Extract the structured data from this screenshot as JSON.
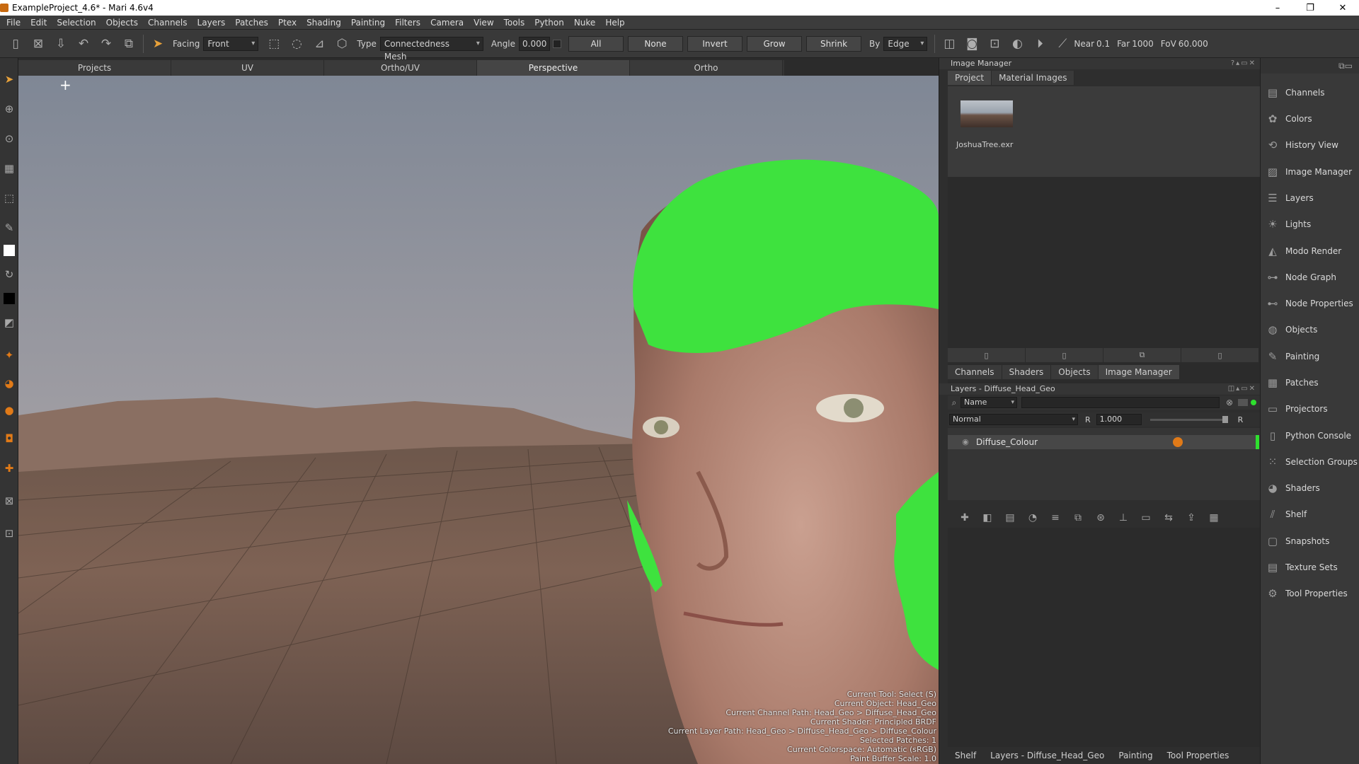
{
  "window": {
    "title": "ExampleProject_4.6* - Mari 4.6v4",
    "minimize": "–",
    "maximize": "❐",
    "close": "✕"
  },
  "menus": [
    "File",
    "Edit",
    "Selection",
    "Objects",
    "Channels",
    "Layers",
    "Patches",
    "Ptex",
    "Shading",
    "Painting",
    "Filters",
    "Camera",
    "View",
    "Tools",
    "Python",
    "Nuke",
    "Help"
  ],
  "toolbar": {
    "facing_label": "Facing",
    "facing_value": "Front",
    "type_label": "Type",
    "type_value": "Connectedness Mesh",
    "angle_label": "Angle",
    "angle_value": "0.000",
    "all": "All",
    "none": "None",
    "invert": "Invert",
    "grow": "Grow",
    "shrink": "Shrink",
    "by_label": "By",
    "by_value": "Edge",
    "near_label": "Near",
    "near_value": "0.1",
    "far_label": "Far",
    "far_value": "1000",
    "fov_label": "FoV",
    "fov_value": "60.000"
  },
  "viewport_tabs": [
    "Projects",
    "UV",
    "Ortho/UV",
    "Perspective",
    "Ortho"
  ],
  "active_viewport_tab": "Perspective",
  "hud": [
    "Current Tool: Select (S)",
    "Current Object: Head_Geo",
    "Current Channel Path: Head_Geo > Diffuse_Head_Geo",
    "Current Shader: Principled BRDF",
    "Current Layer Path: Head_Geo > Diffuse_Head_Geo > Diffuse_Colour",
    "Selected Patches: 1",
    "Current Colorspace: Automatic (sRGB)",
    "Paint Buffer Scale: 1.0"
  ],
  "image_manager": {
    "title": "Image Manager",
    "tabs": [
      "Project",
      "Material Images"
    ],
    "active_tab": "Project",
    "image_label": "JoshuaTree.exr"
  },
  "middle_tabs": [
    "Channels",
    "Shaders",
    "Objects",
    "Image Manager"
  ],
  "active_middle_tab": "Image Manager",
  "layers": {
    "title": "Layers - Diffuse_Head_Geo",
    "filter_field": "Name",
    "blend_mode": "Normal",
    "r_label": "R",
    "opacity": "1.000",
    "r_label2": "R",
    "layer_name": "Diffuse_Colour"
  },
  "bottom_tabs": [
    "Shelf",
    "Layers - Diffuse_Head_Geo",
    "Painting",
    "Tool Properties"
  ],
  "palettes": [
    "Channels",
    "Colors",
    "History View",
    "Image Manager",
    "Layers",
    "Lights",
    "Modo Render",
    "Node Graph",
    "Node Properties",
    "Objects",
    "Painting",
    "Patches",
    "Projectors",
    "Python Console",
    "Selection Groups",
    "Shaders",
    "Shelf",
    "Snapshots",
    "Texture Sets",
    "Tool Properties"
  ],
  "palette_icons": [
    "channels-icon",
    "colors-icon",
    "history-icon",
    "image-manager-icon",
    "layers-icon",
    "lights-icon",
    "modo-render-icon",
    "node-graph-icon",
    "node-properties-icon",
    "objects-icon",
    "painting-icon",
    "patches-icon",
    "projectors-icon",
    "python-console-icon",
    "selection-groups-icon",
    "shaders-icon",
    "shelf-icon",
    "snapshots-icon",
    "texture-sets-icon",
    "tool-properties-icon"
  ],
  "colors": {
    "accent_green": "#2ee02e",
    "lock_orange": "#e07a18"
  }
}
